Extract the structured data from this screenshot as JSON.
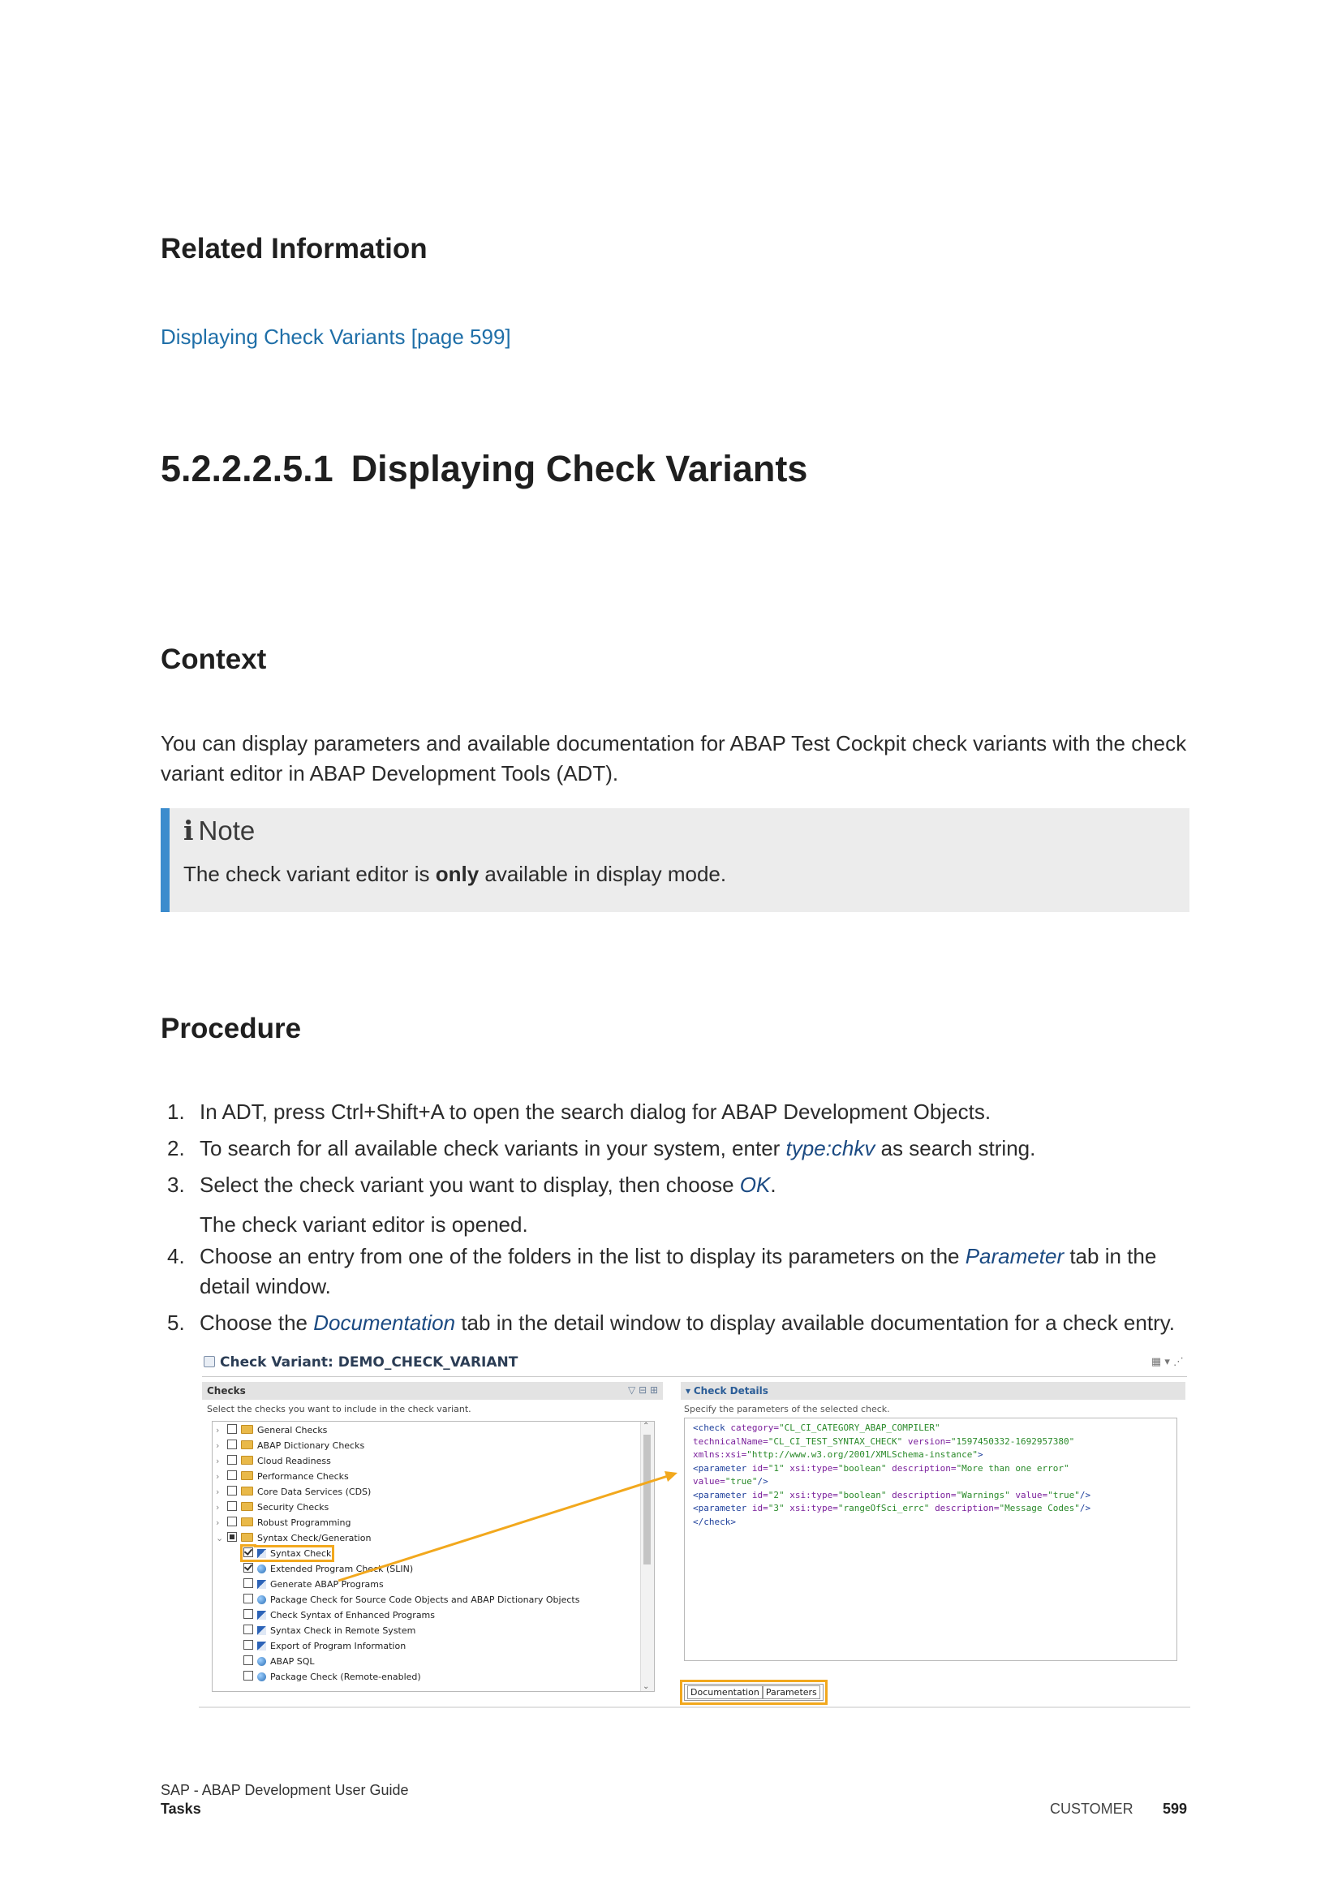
{
  "related": {
    "heading": "Related Information",
    "link": "Displaying Check Variants [page 599]"
  },
  "section": {
    "number": "5.2.2.2.5.1",
    "title": "Displaying Check Variants"
  },
  "context": {
    "heading": "Context",
    "paragraph": "You can display parameters and available documentation for ABAP Test Cockpit check variants with the check variant editor in ABAP Development Tools (ADT).",
    "note_icon": "i",
    "note_title": "Note",
    "note_pre": "The check variant editor is ",
    "note_bold": "only",
    "note_post": " available in display mode."
  },
  "procedure": {
    "heading": "Procedure",
    "steps": [
      {
        "n": "1.",
        "pre": "In ADT, press Ctrl+Shift+A to open the search dialog for ABAP Development Objects.",
        "em": "",
        "post": ""
      },
      {
        "n": "2.",
        "pre": "To search for all available check variants in your system, enter ",
        "em": "type:chkv",
        "post": " as search string."
      },
      {
        "n": "3.",
        "pre": "Select the check variant you want to display, then choose ",
        "em": "OK",
        "post": "."
      },
      {
        "n": "4.",
        "pre": "Choose an entry from one of the folders in the list to display its parameters on the ",
        "em": "Parameter",
        "post": " tab in the detail window."
      },
      {
        "n": "5.",
        "pre": "Choose the ",
        "em": "Documentation",
        "post": " tab in the detail window to display available documentation for a check entry."
      }
    ],
    "step3_result": "The check variant editor is opened."
  },
  "figure": {
    "title": "Check Variant: DEMO_CHECK_VARIANT",
    "checks_header": "Checks",
    "checks_sub": "Select the checks you want to include in the check variant.",
    "folders": [
      "General Checks",
      "ABAP Dictionary Checks",
      "Cloud Readiness",
      "Performance Checks",
      "Core Data Services (CDS)",
      "Security Checks",
      "Robust Programming",
      "Syntax Check/Generation"
    ],
    "children": [
      {
        "label": "Syntax Check",
        "checked": true,
        "icon": "flag-icon"
      },
      {
        "label": "Extended Program Check (SLIN)",
        "checked": true,
        "icon": "dot-icon"
      },
      {
        "label": "Generate ABAP Programs",
        "checked": false,
        "icon": "flag-icon"
      },
      {
        "label": "Package Check for Source Code Objects and ABAP Dictionary Objects",
        "checked": false,
        "icon": "dot-icon"
      },
      {
        "label": "Check Syntax of Enhanced Programs",
        "checked": false,
        "icon": "flag-icon"
      },
      {
        "label": "Syntax Check in Remote System",
        "checked": false,
        "icon": "flag-icon"
      },
      {
        "label": "Export of Program Information",
        "checked": false,
        "icon": "flag-icon"
      },
      {
        "label": "ABAP SQL",
        "checked": false,
        "icon": "dot-icon"
      },
      {
        "label": "Package Check (Remote-enabled)",
        "checked": false,
        "icon": "dot-icon"
      }
    ],
    "details_header": "Check Details",
    "details_sub": "Specify the parameters of the selected check.",
    "xml_lines": [
      "<check category=\"CL_CI_CATEGORY_ABAP_COMPILER\"",
      "technicalName=\"CL_CI_TEST_SYNTAX_CHECK\" version=\"1597450332-1692957380\"",
      "xmlns:xsi=\"http://www.w3.org/2001/XMLSchema-instance\">",
      " <parameter id=\"1\" xsi:type=\"boolean\" description=\"More than one error\"",
      "value=\"true\"/>",
      " <parameter id=\"2\" xsi:type=\"boolean\" description=\"Warnings\" value=\"true\"/>",
      " <parameter id=\"3\" xsi:type=\"rangeOfSci_errc\" description=\"Message Codes\"/>",
      "</check>"
    ],
    "tab_documentation": "Documentation",
    "tab_parameters": "Parameters",
    "highlight_color": "#f2a81d"
  },
  "footer": {
    "doc_title": "SAP - ABAP Development User Guide",
    "chapter": "Tasks",
    "audience": "CUSTOMER",
    "page": "599"
  }
}
